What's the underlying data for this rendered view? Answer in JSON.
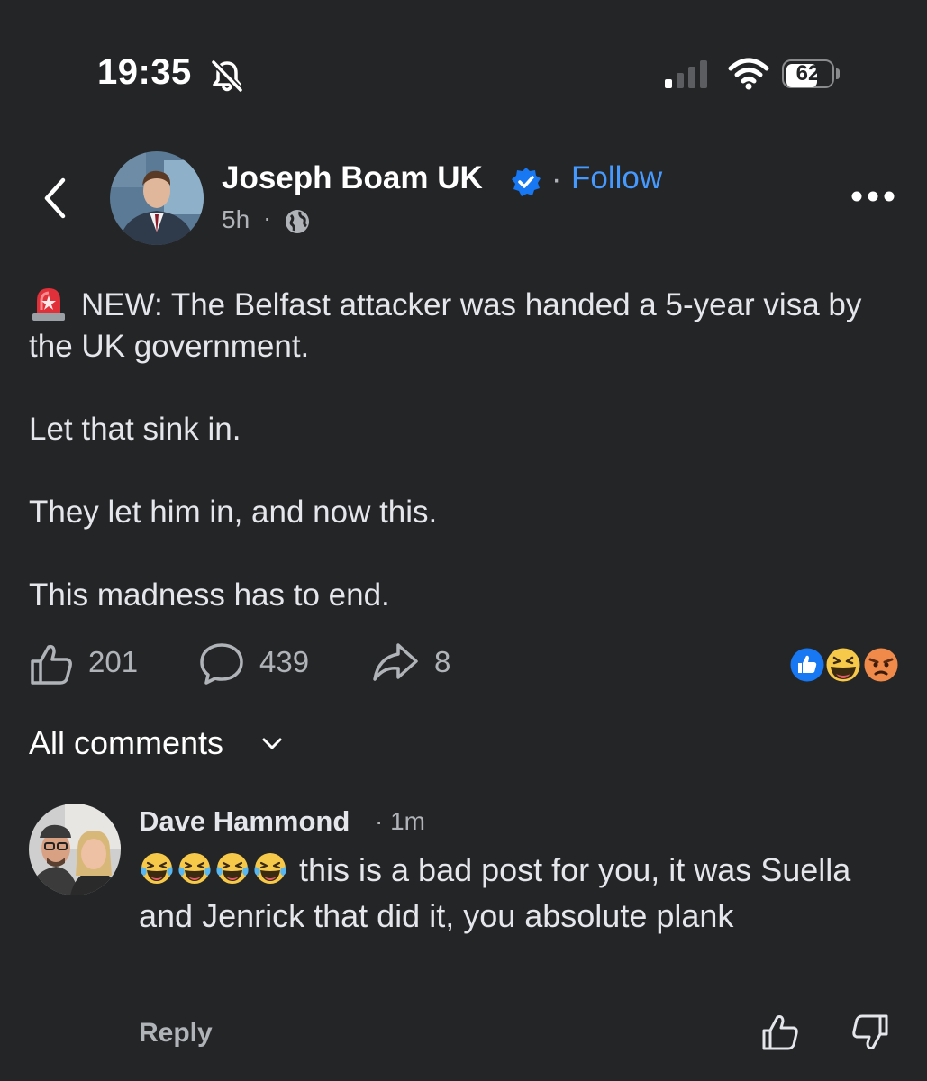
{
  "status_bar": {
    "time": "19:35",
    "battery": "62",
    "icons": [
      "bell-slash-icon",
      "signal-icon",
      "wifi-icon",
      "battery-icon"
    ]
  },
  "header": {
    "author": "Joseph Boam UK",
    "follow_separator": "·",
    "follow_label": "Follow",
    "time": "5h",
    "time_separator": "·",
    "icons": [
      "back-chevron-icon",
      "verified-badge-icon",
      "globe-icon",
      "more-options-icon"
    ]
  },
  "post": {
    "paragraphs": [
      "NEW: The Belfast attacker was handed a 5-year visa by the UK government.",
      "Let that sink in.",
      "They let him in, and now this.",
      "This madness has to end."
    ],
    "leading_emoji": "siren-icon"
  },
  "actions": {
    "likes": "201",
    "comments": "439",
    "shares": "8",
    "reactions": [
      "like-reaction-icon",
      "haha-reaction-icon",
      "angry-reaction-icon"
    ]
  },
  "comments_section": {
    "filter_label": "All comments",
    "comment": {
      "author": "Dave Hammond",
      "separator": "·",
      "time": "1m",
      "text": "this is a bad post for you, it was Suella and Jenrick that did it, you absolute plank",
      "leading_emojis": [
        "laughing-tears-icon",
        "laughing-tears-icon",
        "laughing-tears-icon",
        "laughing-tears-icon"
      ],
      "reply_label": "Reply"
    }
  },
  "colors": {
    "background": "#242526",
    "text": "#e4e6eb",
    "muted": "#b0b3b8",
    "link": "#4599ff",
    "verified": "#1877f2"
  }
}
